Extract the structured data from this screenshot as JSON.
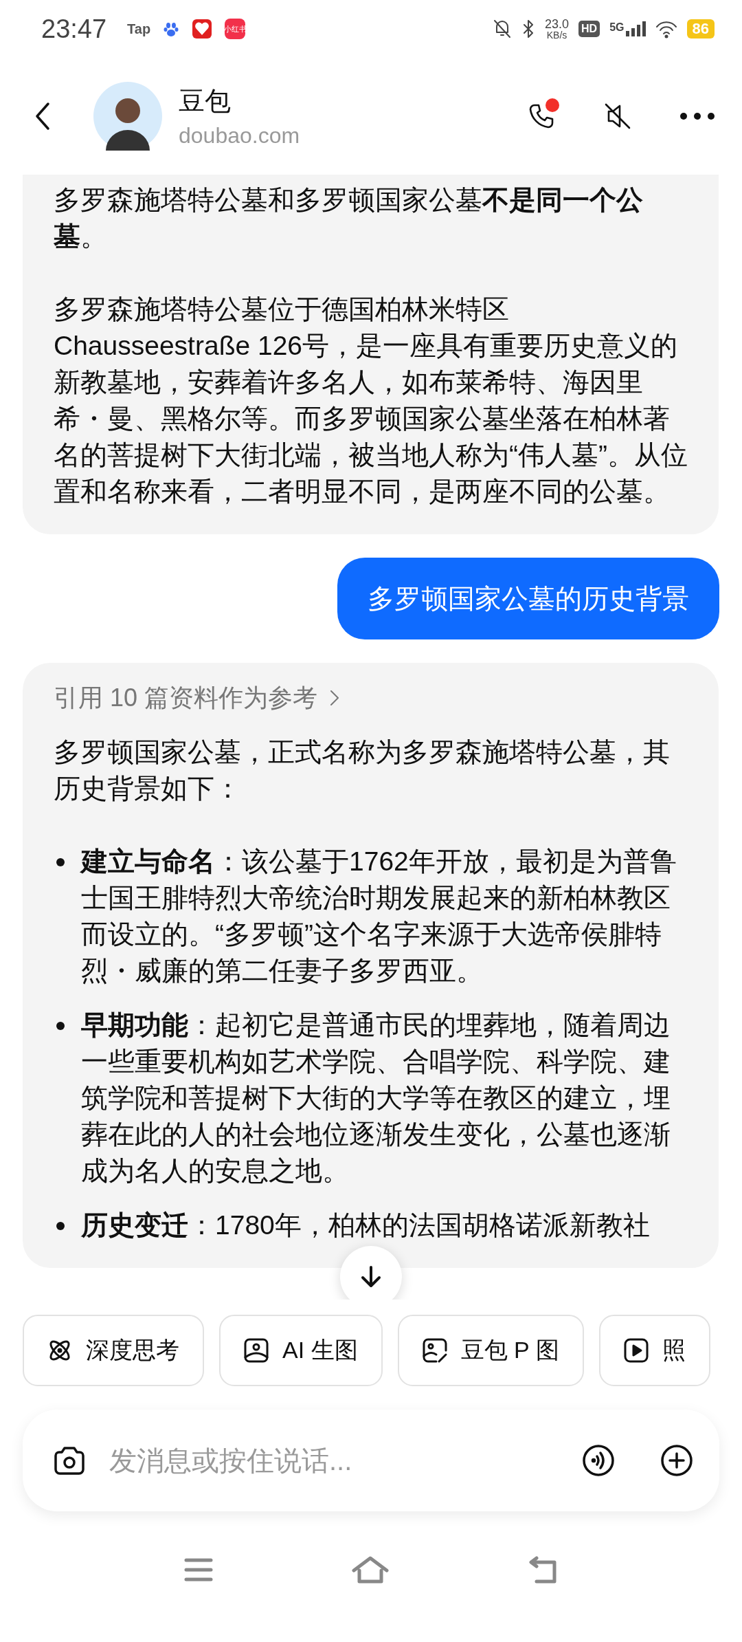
{
  "status_bar": {
    "time": "23:47",
    "app_icons": [
      {
        "kind": "tap",
        "label": "Tap"
      },
      {
        "kind": "paw"
      },
      {
        "kind": "gift"
      },
      {
        "kind": "redbook",
        "label": "小红书"
      }
    ],
    "net_speed": "23.0",
    "net_unit": "KB/s",
    "hd": "HD",
    "network": "5G",
    "battery": "86"
  },
  "header": {
    "title": "豆包",
    "subtitle": "doubao.com",
    "call_badge": true
  },
  "messages": [
    {
      "kind": "bot",
      "paragraphs": [
        "多罗森施塔特公墓和多罗顿国家公墓**不是同一个公墓**。",
        "多罗森施塔特公墓位于德国柏林米特区Chausseestraße 126号，是一座具有重要历史意义的新教墓地，安葬着许多名人，如布莱希特、海因里希・曼、黑格尔等。而多罗顿国家公墓坐落在柏林著名的菩提树下大街北端，被当地人称为“伟人墓”。从位置和名称来看，二者明显不同，是两座不同的公墓。"
      ]
    },
    {
      "kind": "user",
      "text": "多罗顿国家公墓的历史背景"
    },
    {
      "kind": "bot",
      "reference": "引用 10 篇资料作为参考",
      "paragraphs": [
        "多罗顿国家公墓，正式名称为多罗森施塔特公墓，其历史背景如下："
      ],
      "bullets": [
        "**建立与命名**：该公墓于1762年开放，最初是为普鲁士国王腓特烈大帝统治时期发展起来的新柏林教区而设立的。“多罗顿”这个名字来源于大选帝侯腓特烈・威廉的第二任妻子多罗西亚。",
        "**早期功能**：起初它是普通市民的埋葬地，随着周边一些重要机构如艺术学院、合唱学院、科学院、建筑学院和菩提树下大街的大学等在教区的建立，埋葬在此的人的社会地位逐渐发生变化，公墓也逐渐成为名人的安息之地。",
        "**历史变迁**：1780年，柏林的法国胡格诺派新教社"
      ]
    }
  ],
  "chips": [
    {
      "kind": "atom",
      "label": "深度思考"
    },
    {
      "kind": "image",
      "label": "AI 生图"
    },
    {
      "kind": "edit",
      "label": "豆包 P 图"
    },
    {
      "kind": "play",
      "label": "照"
    }
  ],
  "input": {
    "placeholder": "发消息或按住说话..."
  }
}
